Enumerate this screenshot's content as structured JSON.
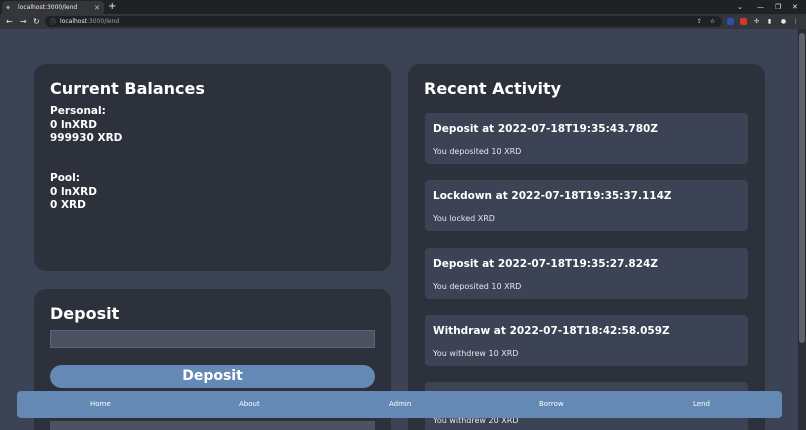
{
  "browser": {
    "tab_title": "localhost:3000/lend",
    "tab_close": "✕",
    "new_tab": "+",
    "url_host": "localhost",
    "url_rest": ":3000/lend"
  },
  "balances": {
    "title": "Current Balances",
    "personal_label": "Personal:",
    "personal_lnxrd": "0 lnXRD",
    "personal_xrd": "999930 XRD",
    "pool_label": "Pool:",
    "pool_lnxrd": "0 lnXRD",
    "pool_xrd": "0 XRD"
  },
  "activity": {
    "title": "Recent Activity",
    "items": [
      {
        "title": "Deposit at 2022-07-18T19:35:43.780Z",
        "desc": "You deposited 10 XRD"
      },
      {
        "title": "Lockdown at 2022-07-18T19:35:37.114Z",
        "desc": "You locked XRD"
      },
      {
        "title": "Deposit at 2022-07-18T19:35:27.824Z",
        "desc": "You deposited 10 XRD"
      },
      {
        "title": "Withdraw at 2022-07-18T18:42:58.059Z",
        "desc": "You withdrew 10 XRD"
      },
      {
        "title": "",
        "desc": "You withdrew 20 XRD"
      }
    ]
  },
  "deposit": {
    "title": "Deposit",
    "button_label": "Deposit"
  },
  "nav": {
    "items": [
      "Home",
      "About",
      "Admin",
      "Borrow",
      "Lend"
    ]
  }
}
